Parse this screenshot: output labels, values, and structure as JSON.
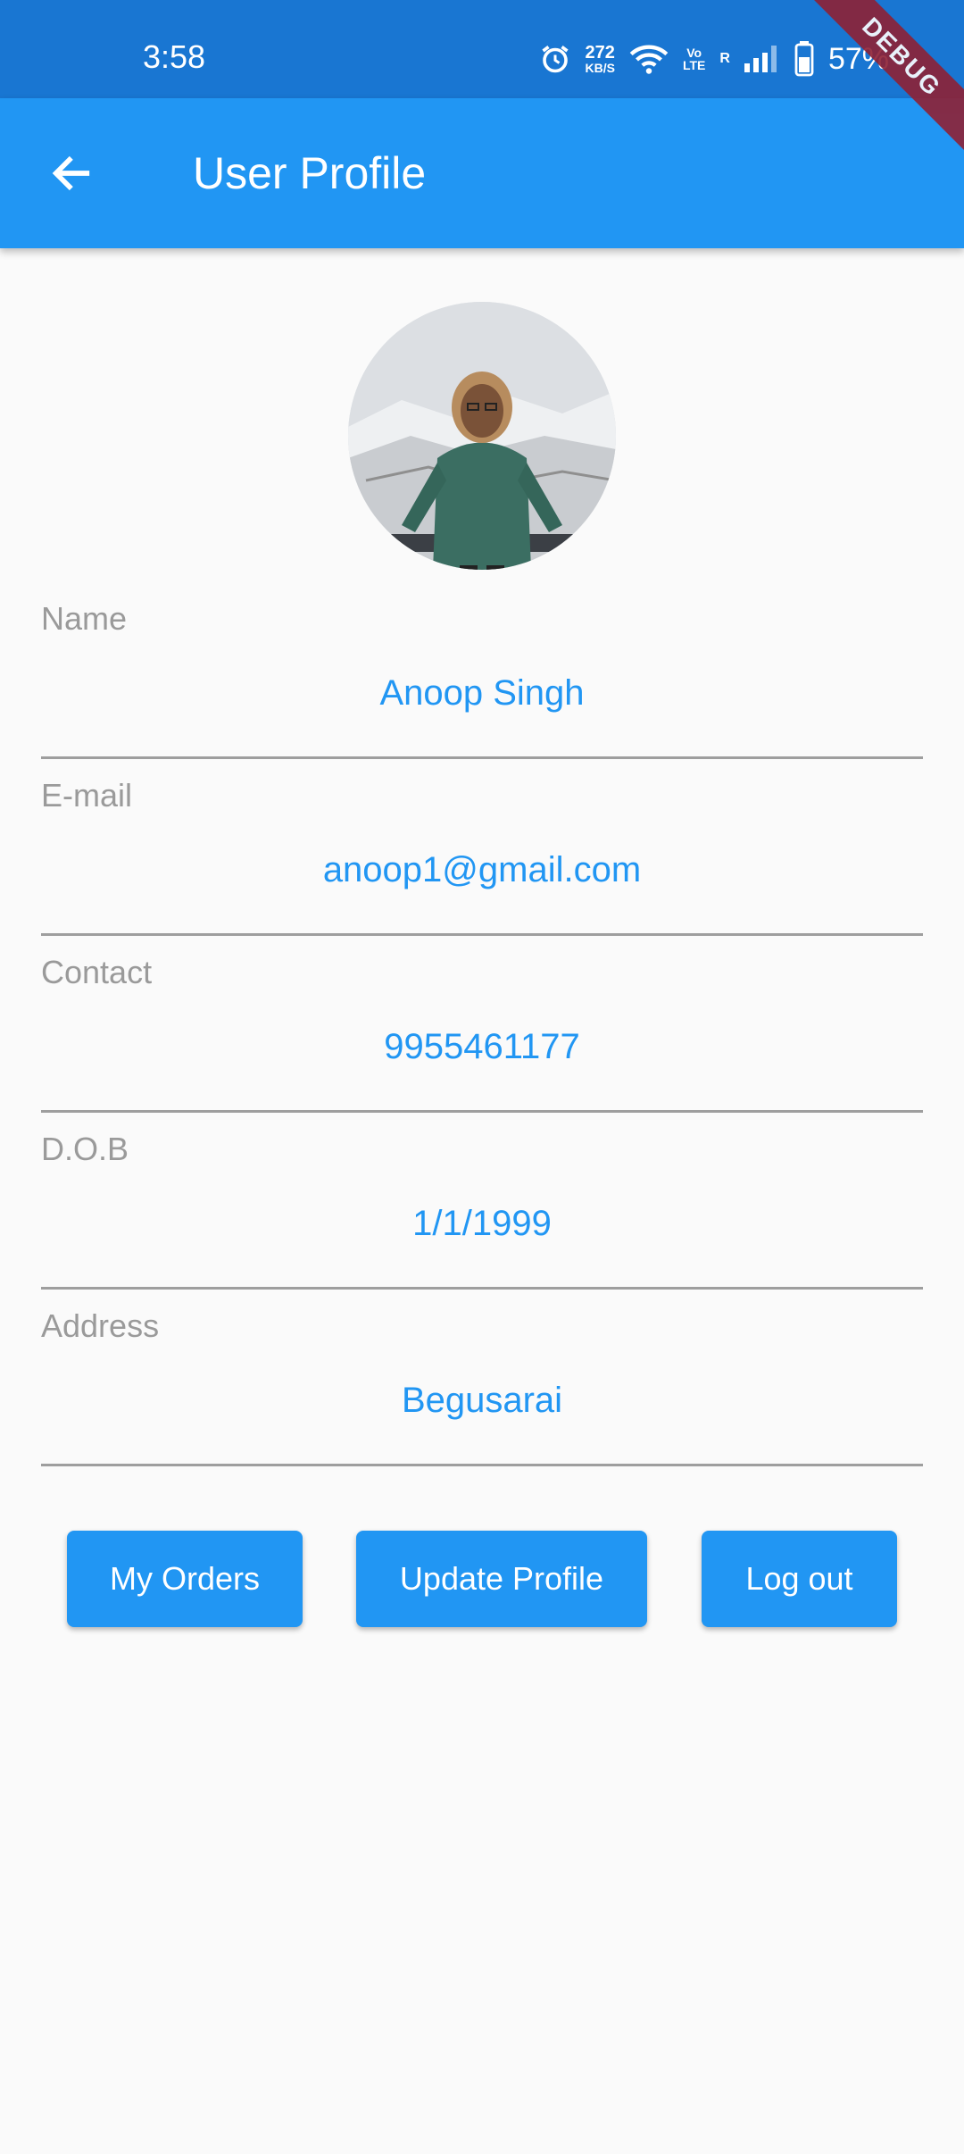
{
  "status_bar": {
    "time": "3:58",
    "net_speed_value": "272",
    "net_speed_unit": "KB/S",
    "volte_top": "Vo",
    "volte_bottom": "LTE",
    "roaming": "R",
    "battery_percent": "57%"
  },
  "debug_banner": "DEBUG",
  "app_bar": {
    "title": "User Profile"
  },
  "fields": [
    {
      "label": "Name",
      "value": "Anoop Singh"
    },
    {
      "label": "E-mail",
      "value": "anoop1@gmail.com"
    },
    {
      "label": "Contact",
      "value": "9955461177"
    },
    {
      "label": "D.O.B",
      "value": "1/1/1999"
    },
    {
      "label": "Address",
      "value": "Begusarai"
    }
  ],
  "buttons": {
    "my_orders": "My Orders",
    "update_profile": "Update Profile",
    "logout": "Log out"
  },
  "colors": {
    "status_bar": "#1976d2",
    "app_bar": "#2196f3",
    "value_text": "#2196f3",
    "label_text": "#9a9a9a"
  },
  "icons": [
    "alarm-icon",
    "wifi-icon",
    "signal-icon",
    "battery-icon",
    "back-arrow-icon"
  ]
}
